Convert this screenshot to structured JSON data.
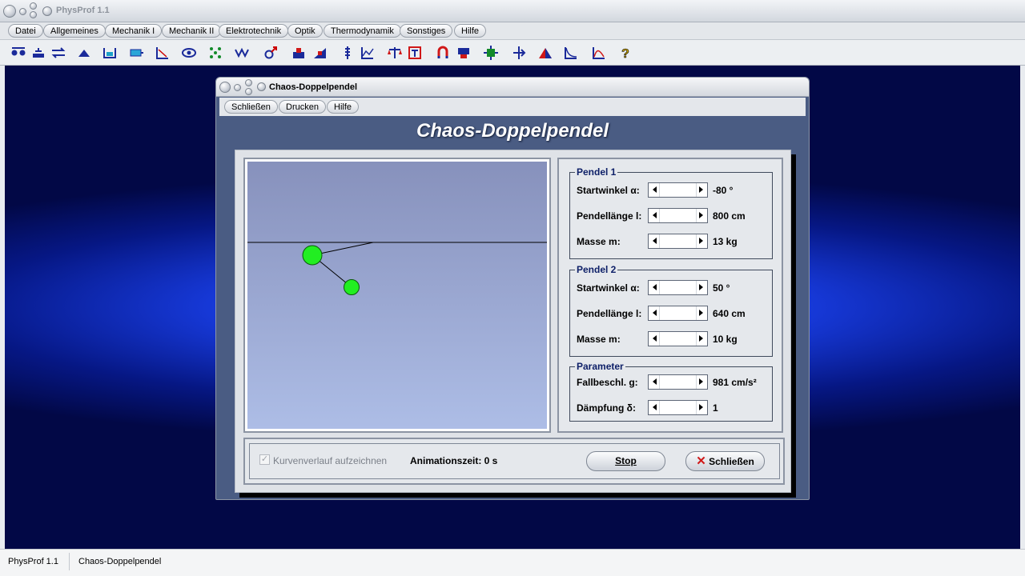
{
  "app": {
    "title": "PhysProf 1.1"
  },
  "menubar": {
    "items": [
      "Datei",
      "Allgemeines",
      "Mechanik I",
      "Mechanik II",
      "Elektrotechnik",
      "Optik",
      "Thermodynamik",
      "Sonstiges",
      "Hilfe"
    ]
  },
  "toolbar": {
    "icons": [
      "collision-icon",
      "balance-icon",
      "exchange-icon",
      "arch-icon",
      "level-icon",
      "tank-icon",
      "graph-icon",
      "eye-icon",
      "grid-icon",
      "wave-icon",
      "gender-icon",
      "weight-icon",
      "tilt-icon",
      "spring-icon",
      "chart-icon",
      "scale-icon",
      "frame-icon",
      "magnet-icon",
      "robot-icon",
      "circuit-icon",
      "lens-icon",
      "triangle-icon",
      "curve-icon",
      "distribution-icon",
      "help-icon"
    ]
  },
  "dialog": {
    "title": "Chaos-Doppelpendel",
    "menu": [
      "Schließen",
      "Drucken",
      "Hilfe"
    ],
    "heading": "Chaos-Doppelpendel",
    "pendel1": {
      "label": "Pendel 1",
      "startwinkel_label": "Startwinkel α:",
      "startwinkel_value": "-80 °",
      "laenge_label": "Pendellänge l:",
      "laenge_value": "800 cm",
      "masse_label": "Masse m:",
      "masse_value": "13 kg"
    },
    "pendel2": {
      "label": "Pendel 2",
      "startwinkel_label": "Startwinkel α:",
      "startwinkel_value": "50 °",
      "laenge_label": "Pendellänge l:",
      "laenge_value": "640 cm",
      "masse_label": "Masse m:",
      "masse_value": "10 kg"
    },
    "parameter": {
      "label": "Parameter",
      "g_label": "Fallbeschl. g:",
      "g_value": "981 cm/s²",
      "d_label": "Dämpfung δ:",
      "d_value": "1"
    },
    "bottom": {
      "checkbox_label": "Kurvenverlauf aufzeichnen",
      "checkbox_checked": true,
      "animation_time": "Animationszeit: 0 s",
      "stop_label": "Stop",
      "close_label": "Schließen"
    }
  },
  "statusbar": {
    "app": "PhysProf 1.1",
    "module": "Chaos-Doppelpendel"
  },
  "colors": {
    "bob": "#22ee22",
    "desktop_glow": "#3c6dff",
    "heading": "#ffffff"
  }
}
